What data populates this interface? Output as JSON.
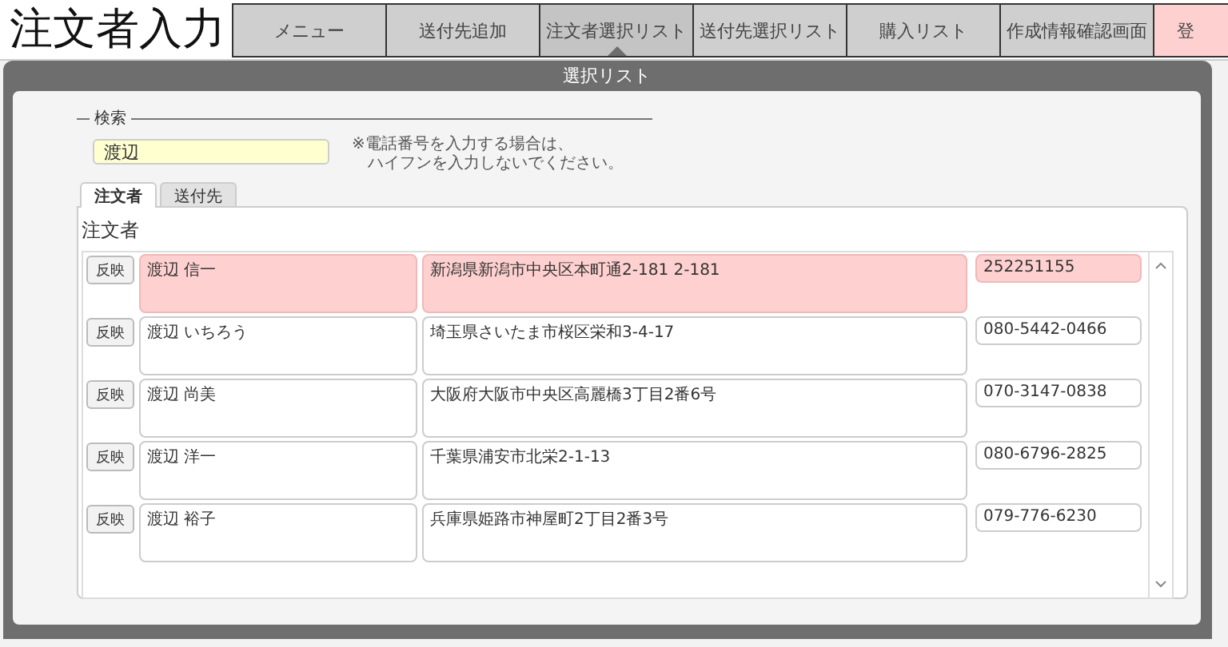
{
  "title": "注文者入力",
  "nav": [
    {
      "label": "メニュー",
      "kind": "normal",
      "selected": false
    },
    {
      "label": "送付先追加",
      "kind": "normal",
      "selected": false
    },
    {
      "label": "注文者選択リスト",
      "kind": "normal",
      "selected": true
    },
    {
      "label": "送付先選択リスト",
      "kind": "normal",
      "selected": false
    },
    {
      "label": "購入リスト",
      "kind": "normal",
      "selected": false
    },
    {
      "label": "作成情報確認画面",
      "kind": "normal",
      "selected": false
    },
    {
      "label": "登",
      "kind": "accent",
      "selected": false
    }
  ],
  "dialog": {
    "title": "選択リスト",
    "search": {
      "legend": "検索",
      "value": "渡辺",
      "note": [
        "※電話番号を入力する場合は、",
        "ハイフンを入力しないでください。"
      ]
    },
    "tabs": [
      {
        "label": "注文者",
        "selected": true
      },
      {
        "label": "送付先",
        "selected": false
      }
    ],
    "section_title": "注文者",
    "rows": [
      {
        "button": "反映",
        "name": "渡辺 信一",
        "address": "新潟県新潟市中央区本町通2-181 2-181",
        "phone": "252251155",
        "selected": true
      },
      {
        "button": "反映",
        "name": "渡辺 いちろう",
        "address": "埼玉県さいたま市桜区栄和3-4-17",
        "phone": "080-5442-0466",
        "selected": false
      },
      {
        "button": "反映",
        "name": "渡辺 尚美",
        "address": "大阪府大阪市中央区高麗橋3丁目2番6号",
        "phone": "070-3147-0838",
        "selected": false
      },
      {
        "button": "反映",
        "name": "渡辺 洋一",
        "address": "千葉県浦安市北栄2-1-13",
        "phone": "080-6796-2825",
        "selected": false
      },
      {
        "button": "反映",
        "name": "渡辺 裕子",
        "address": "兵庫県姫路市神屋町2丁目2番3号",
        "phone": "079-776-6230",
        "selected": false
      }
    ]
  }
}
